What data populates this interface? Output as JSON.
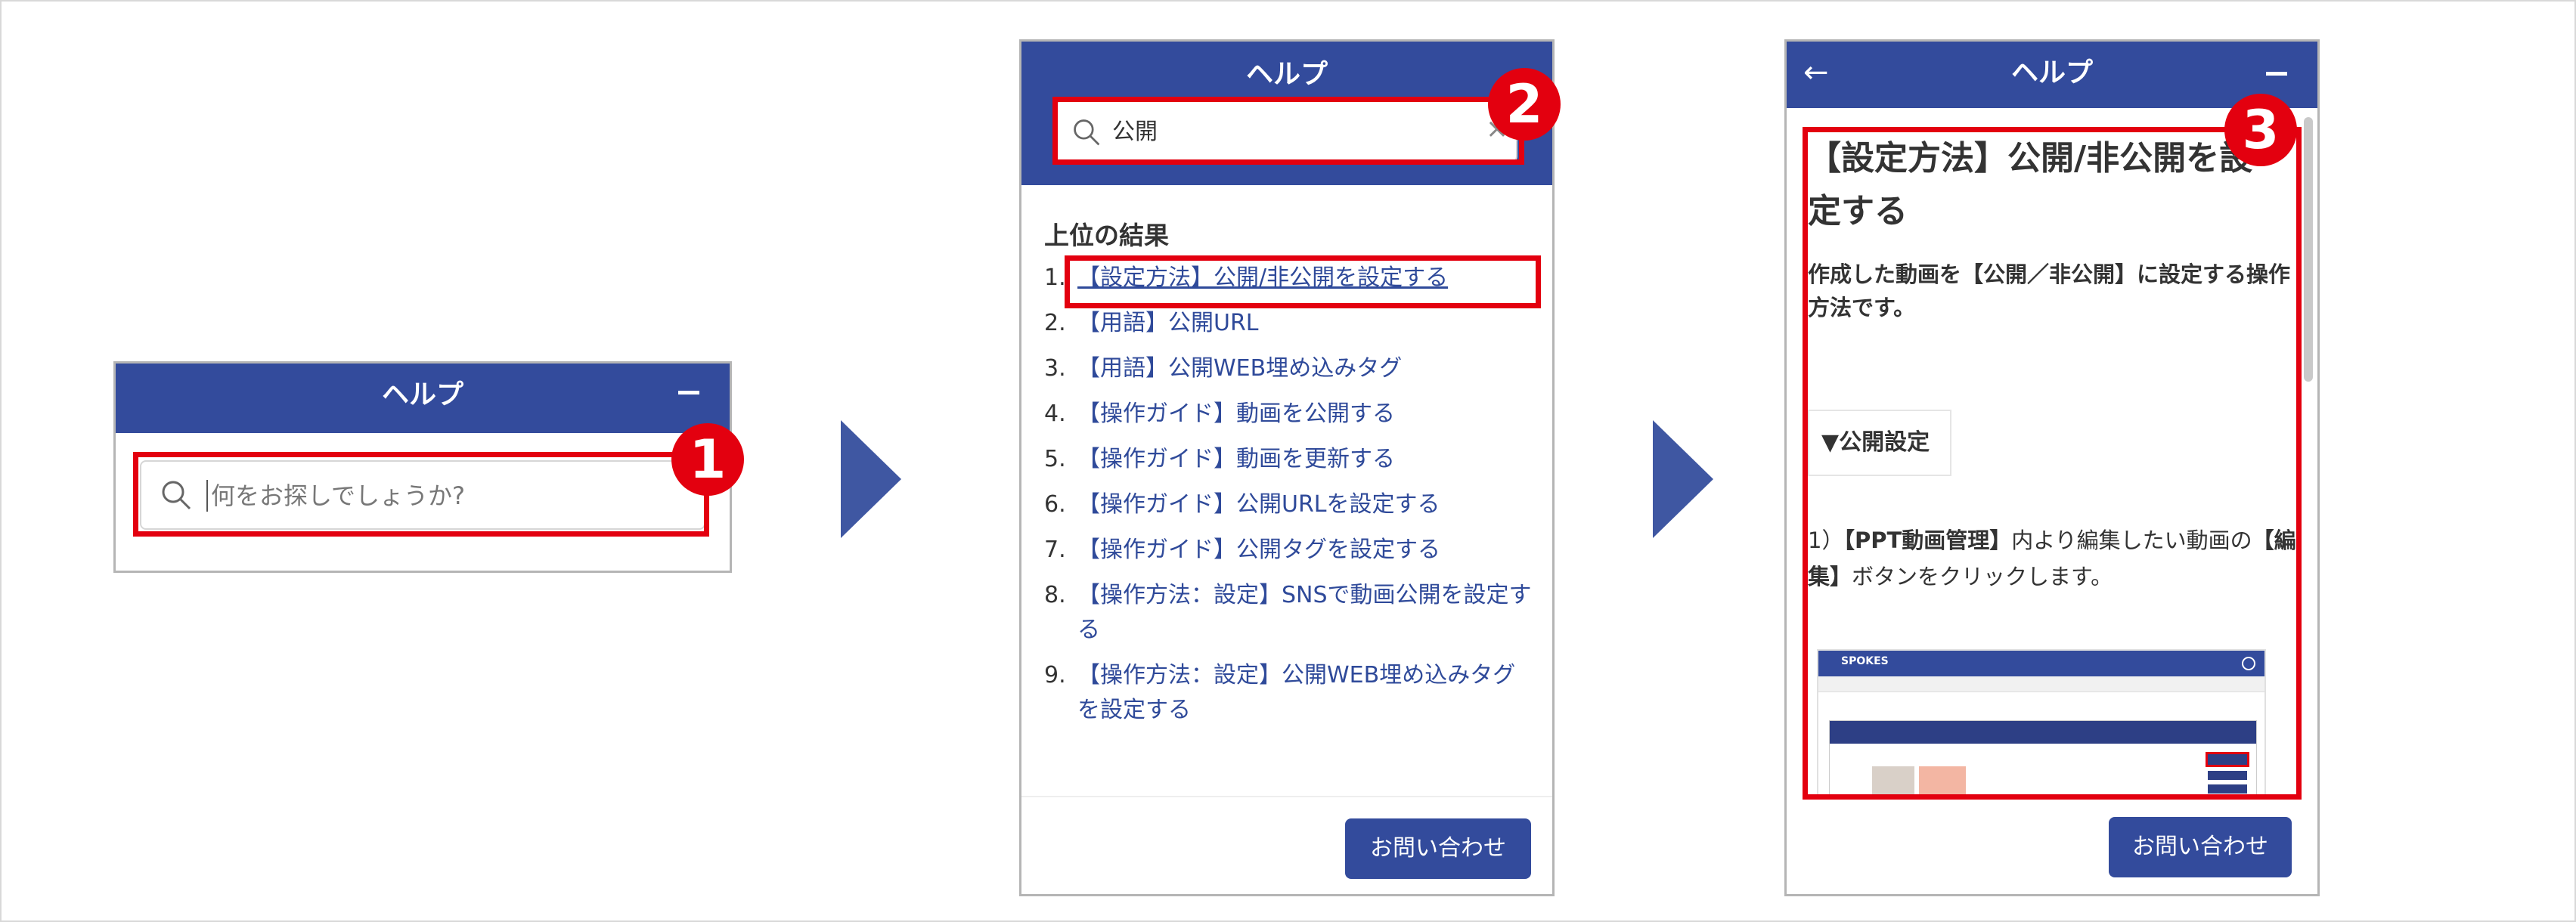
{
  "colors": {
    "header": "#334b9c",
    "highlight": "#e3000f",
    "arrow": "#3f57a2",
    "link": "#2f4a9a"
  },
  "badges": [
    "1",
    "2",
    "3"
  ],
  "panel1": {
    "title": "ヘルプ",
    "search_placeholder": "何をお探しでしょうか?",
    "icons": [
      "search-icon",
      "minimize-icon"
    ]
  },
  "panel2": {
    "title": "ヘルプ",
    "search_value": "公開",
    "clear_icon": "×",
    "results_heading": "上位の結果",
    "results": [
      {
        "num": "1.",
        "text": "【設定方法】公開/非公開を設定する"
      },
      {
        "num": "2.",
        "text": "【用語】公開URL"
      },
      {
        "num": "3.",
        "text": "【用語】公開WEB埋め込みタグ"
      },
      {
        "num": "4.",
        "text": "【操作ガイド】動画を公開する"
      },
      {
        "num": "5.",
        "text": "【操作ガイド】動画を更新する"
      },
      {
        "num": "6.",
        "text": "【操作ガイド】公開URLを設定する"
      },
      {
        "num": "7.",
        "text": "【操作ガイド】公開タグを設定する"
      },
      {
        "num": "8.",
        "text": "【操作方法：設定】SNSで動画公開を設定する"
      },
      {
        "num": "9.",
        "text": "【操作方法：設定】公開WEB埋め込みタグを設定する"
      }
    ],
    "contact_label": "お問い合わせ"
  },
  "panel3": {
    "title": "ヘルプ",
    "back_icon": "←",
    "article_title": "【設定方法】公開/非公開を設定する",
    "article_desc": "作成した動画を【公開／非公開】に設定する操作方法です。",
    "section_heading": "▼公開設定",
    "step_prefix": "1）",
    "step_bold1": "【PPT動画管理】",
    "step_mid": "内より編集したい動画の",
    "step_bold2": "【編集】",
    "step_end": "ボタンをクリックします。",
    "screenshot_brand": "SPOKES",
    "contact_label": "お問い合わせ"
  }
}
